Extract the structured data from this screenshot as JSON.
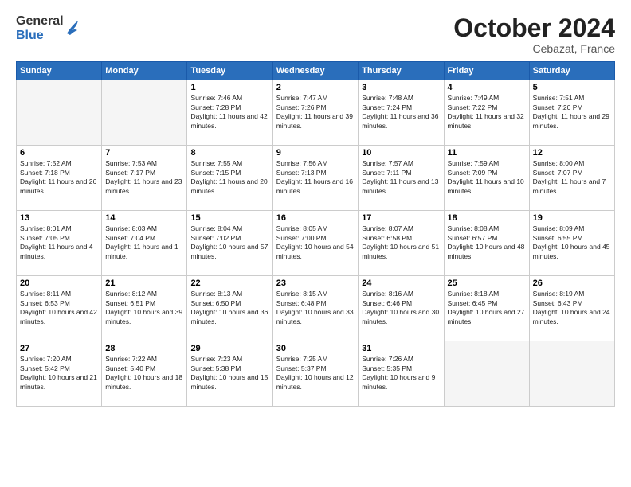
{
  "logo": {
    "general": "General",
    "blue": "Blue"
  },
  "title": "October 2024",
  "location": "Cebazat, France",
  "days_of_week": [
    "Sunday",
    "Monday",
    "Tuesday",
    "Wednesday",
    "Thursday",
    "Friday",
    "Saturday"
  ],
  "weeks": [
    [
      {
        "day": "",
        "info": ""
      },
      {
        "day": "",
        "info": ""
      },
      {
        "day": "1",
        "info": "Sunrise: 7:46 AM\nSunset: 7:28 PM\nDaylight: 11 hours and 42 minutes."
      },
      {
        "day": "2",
        "info": "Sunrise: 7:47 AM\nSunset: 7:26 PM\nDaylight: 11 hours and 39 minutes."
      },
      {
        "day": "3",
        "info": "Sunrise: 7:48 AM\nSunset: 7:24 PM\nDaylight: 11 hours and 36 minutes."
      },
      {
        "day": "4",
        "info": "Sunrise: 7:49 AM\nSunset: 7:22 PM\nDaylight: 11 hours and 32 minutes."
      },
      {
        "day": "5",
        "info": "Sunrise: 7:51 AM\nSunset: 7:20 PM\nDaylight: 11 hours and 29 minutes."
      }
    ],
    [
      {
        "day": "6",
        "info": "Sunrise: 7:52 AM\nSunset: 7:18 PM\nDaylight: 11 hours and 26 minutes."
      },
      {
        "day": "7",
        "info": "Sunrise: 7:53 AM\nSunset: 7:17 PM\nDaylight: 11 hours and 23 minutes."
      },
      {
        "day": "8",
        "info": "Sunrise: 7:55 AM\nSunset: 7:15 PM\nDaylight: 11 hours and 20 minutes."
      },
      {
        "day": "9",
        "info": "Sunrise: 7:56 AM\nSunset: 7:13 PM\nDaylight: 11 hours and 16 minutes."
      },
      {
        "day": "10",
        "info": "Sunrise: 7:57 AM\nSunset: 7:11 PM\nDaylight: 11 hours and 13 minutes."
      },
      {
        "day": "11",
        "info": "Sunrise: 7:59 AM\nSunset: 7:09 PM\nDaylight: 11 hours and 10 minutes."
      },
      {
        "day": "12",
        "info": "Sunrise: 8:00 AM\nSunset: 7:07 PM\nDaylight: 11 hours and 7 minutes."
      }
    ],
    [
      {
        "day": "13",
        "info": "Sunrise: 8:01 AM\nSunset: 7:05 PM\nDaylight: 11 hours and 4 minutes."
      },
      {
        "day": "14",
        "info": "Sunrise: 8:03 AM\nSunset: 7:04 PM\nDaylight: 11 hours and 1 minute."
      },
      {
        "day": "15",
        "info": "Sunrise: 8:04 AM\nSunset: 7:02 PM\nDaylight: 10 hours and 57 minutes."
      },
      {
        "day": "16",
        "info": "Sunrise: 8:05 AM\nSunset: 7:00 PM\nDaylight: 10 hours and 54 minutes."
      },
      {
        "day": "17",
        "info": "Sunrise: 8:07 AM\nSunset: 6:58 PM\nDaylight: 10 hours and 51 minutes."
      },
      {
        "day": "18",
        "info": "Sunrise: 8:08 AM\nSunset: 6:57 PM\nDaylight: 10 hours and 48 minutes."
      },
      {
        "day": "19",
        "info": "Sunrise: 8:09 AM\nSunset: 6:55 PM\nDaylight: 10 hours and 45 minutes."
      }
    ],
    [
      {
        "day": "20",
        "info": "Sunrise: 8:11 AM\nSunset: 6:53 PM\nDaylight: 10 hours and 42 minutes."
      },
      {
        "day": "21",
        "info": "Sunrise: 8:12 AM\nSunset: 6:51 PM\nDaylight: 10 hours and 39 minutes."
      },
      {
        "day": "22",
        "info": "Sunrise: 8:13 AM\nSunset: 6:50 PM\nDaylight: 10 hours and 36 minutes."
      },
      {
        "day": "23",
        "info": "Sunrise: 8:15 AM\nSunset: 6:48 PM\nDaylight: 10 hours and 33 minutes."
      },
      {
        "day": "24",
        "info": "Sunrise: 8:16 AM\nSunset: 6:46 PM\nDaylight: 10 hours and 30 minutes."
      },
      {
        "day": "25",
        "info": "Sunrise: 8:18 AM\nSunset: 6:45 PM\nDaylight: 10 hours and 27 minutes."
      },
      {
        "day": "26",
        "info": "Sunrise: 8:19 AM\nSunset: 6:43 PM\nDaylight: 10 hours and 24 minutes."
      }
    ],
    [
      {
        "day": "27",
        "info": "Sunrise: 7:20 AM\nSunset: 5:42 PM\nDaylight: 10 hours and 21 minutes."
      },
      {
        "day": "28",
        "info": "Sunrise: 7:22 AM\nSunset: 5:40 PM\nDaylight: 10 hours and 18 minutes."
      },
      {
        "day": "29",
        "info": "Sunrise: 7:23 AM\nSunset: 5:38 PM\nDaylight: 10 hours and 15 minutes."
      },
      {
        "day": "30",
        "info": "Sunrise: 7:25 AM\nSunset: 5:37 PM\nDaylight: 10 hours and 12 minutes."
      },
      {
        "day": "31",
        "info": "Sunrise: 7:26 AM\nSunset: 5:35 PM\nDaylight: 10 hours and 9 minutes."
      },
      {
        "day": "",
        "info": ""
      },
      {
        "day": "",
        "info": ""
      }
    ]
  ]
}
